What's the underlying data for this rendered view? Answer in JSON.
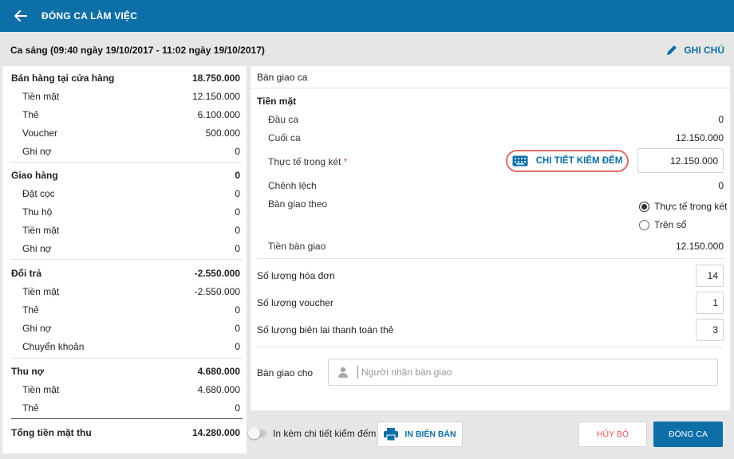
{
  "header": {
    "title": "ĐÓNG CA LÀM VIỆC"
  },
  "shift": {
    "label": "Ca sáng (09:40 ngày 19/10/2017 - 11:02 ngày 19/10/2017)",
    "note_label": "GHI CHÚ"
  },
  "summary": {
    "store_sales": {
      "label": "Bán hàng tại cửa hàng",
      "value": "18.750.000",
      "items": [
        {
          "label": "Tiền mặt",
          "value": "12.150.000"
        },
        {
          "label": "Thẻ",
          "value": "6.100.000"
        },
        {
          "label": "Voucher",
          "value": "500.000"
        },
        {
          "label": "Ghi nợ",
          "value": "0"
        }
      ]
    },
    "delivery": {
      "label": "Giao hàng",
      "value": "0",
      "items": [
        {
          "label": "Đặt cọc",
          "value": "0"
        },
        {
          "label": "Thu hộ",
          "value": "0"
        },
        {
          "label": "Tiền mặt",
          "value": "0"
        },
        {
          "label": "Ghi nợ",
          "value": "0"
        }
      ]
    },
    "returns": {
      "label": "Đổi trả",
      "value": "-2.550.000",
      "items": [
        {
          "label": "Tiền mặt",
          "value": "-2.550.000"
        },
        {
          "label": "Thẻ",
          "value": "0"
        },
        {
          "label": "Ghi nợ",
          "value": "0"
        },
        {
          "label": "Chuyển khoản",
          "value": "0"
        }
      ]
    },
    "debt": {
      "label": "Thu nợ",
      "value": "4.680.000",
      "items": [
        {
          "label": "Tiền mặt",
          "value": "4.680.000"
        },
        {
          "label": "Thẻ",
          "value": "0"
        }
      ]
    },
    "total": {
      "label": "Tổng tiền mặt thu",
      "value": "14.280.000"
    }
  },
  "handover": {
    "title": "Bàn giao ca",
    "cash_section": "Tiền mặt",
    "opening": {
      "label": "Đầu ca",
      "value": "0"
    },
    "closing": {
      "label": "Cuối ca",
      "value": "12.150.000"
    },
    "actual": {
      "label": "Thực tế trong két",
      "required_mark": "*",
      "value": "12.150.000"
    },
    "detail_button": "CHI TIẾT KIỂM ĐẾM",
    "difference": {
      "label": "Chênh lệch",
      "value": "0"
    },
    "handover_by": {
      "label": "Bàn giao theo",
      "options": [
        {
          "label": "Thực tế trong két",
          "selected": true
        },
        {
          "label": "Trên sổ",
          "selected": false
        }
      ]
    },
    "handover_amount": {
      "label": "Tiền bàn giao",
      "value": "12.150.000"
    },
    "invoice_count": {
      "label": "Số lượng hóa đơn",
      "value": "14"
    },
    "voucher_count": {
      "label": "Số lượng voucher",
      "value": "1"
    },
    "card_receipt_count": {
      "label": "Số lượng biên lai thanh toán thẻ",
      "value": "3"
    },
    "handover_to": {
      "label": "Bàn giao cho",
      "placeholder": "Người nhận bàn giao"
    }
  },
  "footer": {
    "include_detail_label": "In kèm chi tiết kiểm đếm",
    "print_label": "IN BIÊN BẢN",
    "cancel_label": "HỦY BỎ",
    "close_label": "ĐÓNG CA"
  },
  "colors": {
    "primary": "#0d6fa8",
    "danger": "#e0584d",
    "highlight": "#e06a6a"
  }
}
